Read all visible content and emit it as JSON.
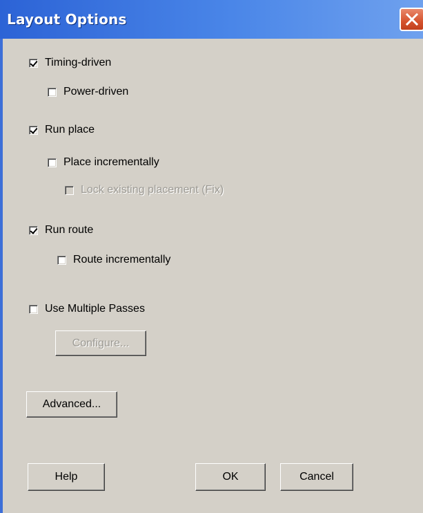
{
  "window": {
    "title": "Layout Options",
    "close_icon": "close-icon"
  },
  "options": {
    "timing_driven": {
      "label": "Timing-driven",
      "checked": true,
      "enabled": true
    },
    "power_driven": {
      "label": "Power-driven",
      "checked": false,
      "enabled": true
    },
    "run_place": {
      "label": "Run place",
      "checked": true,
      "enabled": true
    },
    "place_incrementally": {
      "label": "Place incrementally",
      "checked": false,
      "enabled": true
    },
    "lock_existing_placement": {
      "label": "Lock existing placement (Fix)",
      "checked": false,
      "enabled": false
    },
    "run_route": {
      "label": "Run route",
      "checked": true,
      "enabled": true
    },
    "route_incrementally": {
      "label": "Route incrementally",
      "checked": false,
      "enabled": true
    },
    "use_multiple_passes": {
      "label": "Use Multiple Passes",
      "checked": false,
      "enabled": true
    }
  },
  "buttons": {
    "configure": "Configure...",
    "advanced": "Advanced...",
    "help": "Help",
    "ok": "OK",
    "cancel": "Cancel"
  },
  "colors": {
    "titlebar": "#2c63d6",
    "close_button": "#d5532e",
    "dialog_face": "#d4d0c8",
    "disabled_text": "#9c9a94"
  }
}
